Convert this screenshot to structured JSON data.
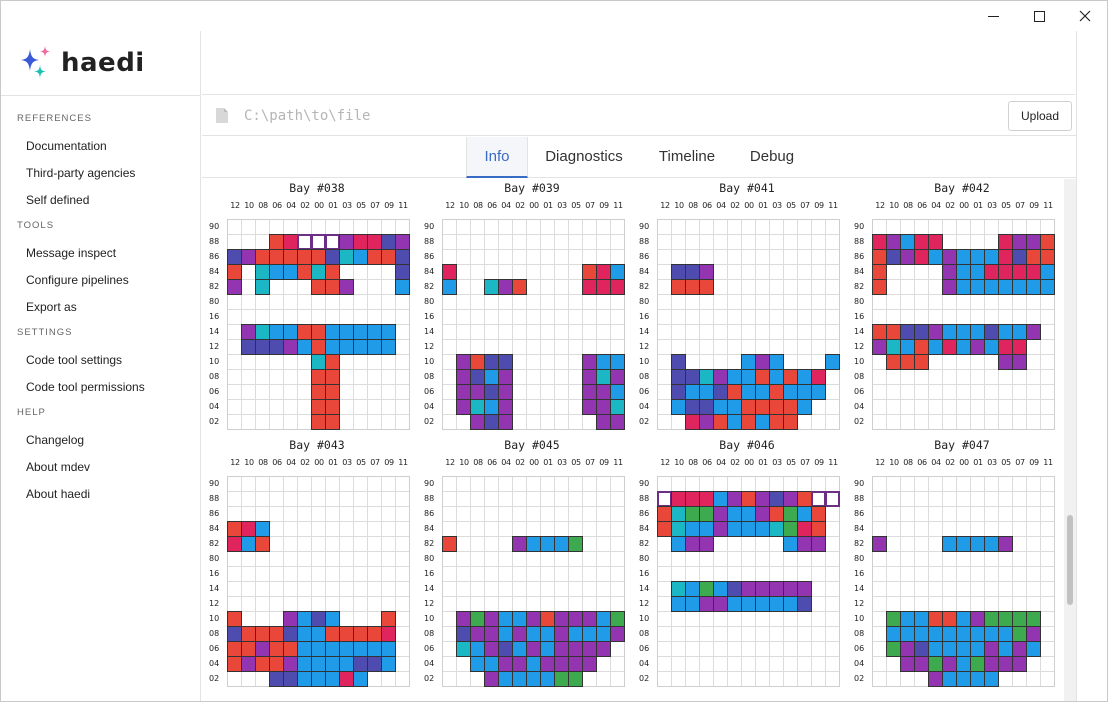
{
  "window": {
    "minimize_label": "—",
    "maximize_label": "☐",
    "close_label": "✕"
  },
  "app": {
    "name": "haedi"
  },
  "sidebar": {
    "sections": [
      {
        "title": "REFERENCES",
        "items": [
          "Documentation",
          "Third-party agencies",
          "Self defined"
        ]
      },
      {
        "title": "TOOLS",
        "items": [
          "Message inspect",
          "Configure pipelines",
          "Export as"
        ]
      },
      {
        "title": "SETTINGS",
        "items": [
          "Code tool settings",
          "Code tool permissions"
        ]
      },
      {
        "title": "HELP",
        "items": [
          "Changelog",
          "About mdev",
          "About haedi"
        ]
      }
    ]
  },
  "file": {
    "placeholder": "C:\\path\\to\\file",
    "upload_label": "Upload"
  },
  "tabs": [
    {
      "label": "Info",
      "active": true
    },
    {
      "label": "Diagnostics",
      "active": false
    },
    {
      "label": "Timeline",
      "active": false
    },
    {
      "label": "Debug",
      "active": false
    }
  ],
  "colors": {
    "accent": "#3a6bc4",
    "R": "#e8473a",
    "P": "#e0245e",
    "V": "#9334b0",
    "I": "#4f4cb0",
    "B": "#1f9be8",
    "T": "#1bb7c4",
    "G": "#3daa4f",
    "E": "#ffffff"
  },
  "bay_labels": {
    "columns": [
      "12",
      "10",
      "08",
      "06",
      "04",
      "02",
      "00",
      "01",
      "03",
      "05",
      "07",
      "09",
      "11"
    ],
    "rows": [
      "90",
      "88",
      "86",
      "84",
      "82",
      "80",
      "16",
      "14",
      "12",
      "10",
      "08",
      "06",
      "04",
      "02"
    ]
  },
  "bays": [
    {
      "title": "Bay #038",
      "rows": [
        ".............",
        "...RPEEEVPPIV",
        "IVRRRRRITBRRI",
        "R.TBBRTR....I",
        "V.T...RRV...B",
        ".............",
        ".............",
        ".VTBBRRBBBBB.",
        ".IIIVBRBBBBB.",
        "......TR.....",
        "......RR.....",
        "......RR.....",
        "......RR.....",
        "......RR....."
      ]
    },
    {
      "title": "Bay #039",
      "rows": [
        ".............",
        ".............",
        ".............",
        "P.........RPB",
        "B..TVR....PPP",
        ".............",
        ".............",
        ".............",
        ".............",
        ".VRII.....VBB",
        ".VIBV.....VTV",
        ".VVIV.....VVB",
        ".VTBV.....VVT",
        "..VIV......VV"
      ]
    },
    {
      "title": "Bay #041",
      "rows": [
        ".............",
        ".............",
        ".............",
        ".IIV.........",
        ".RRR.........",
        ".............",
        ".............",
        ".............",
        ".............",
        ".I....BVB...B",
        ".IITVBBRBRBP.",
        ".IBBIRBBRBBB.",
        ".BIIBBRRRRB..",
        "..PVRBRBRR..."
      ]
    },
    {
      "title": "Bay #042",
      "rows": [
        ".............",
        "PVBPP....PVVR",
        "RIVPBVBBBPIRR",
        "R....VBBPPPPB",
        "R....VBBBBBBB",
        ".............",
        ".............",
        "RRIIVBBBIBBV.",
        "VTBRBPBVBPP..",
        ".RRR.....VV.."
      ]
    },
    {
      "title": "Bay #043",
      "rows": [
        ".............",
        ".............",
        ".............",
        "RPB..........",
        "PBR..........",
        ".............",
        ".............",
        ".............",
        ".............",
        "R...VBIB...R.",
        "IRRRIBBRRRRP.",
        "RRVRRBBBBBBB.",
        "RVRRVBBBBIIB.",
        "...IIBBBPB..."
      ]
    },
    {
      "title": "Bay #045",
      "rows": [
        ".............",
        ".............",
        ".............",
        ".............",
        "R....VBBBG...",
        ".............",
        ".............",
        ".............",
        ".............",
        ".VGVBBVRVVVBG",
        ".IVVBVBBVBBBV",
        ".TBVIBVBVVVV.",
        "..BBVVBVVVV..",
        "...VBBBBGG..."
      ]
    },
    {
      "title": "Bay #046",
      "rows": [
        ".............",
        "EPPPBVRVIVREE",
        "RTGGVBBVRGBR.",
        "RTBBVBBBTGPR.",
        ".BVV.....BVV.",
        ".............",
        ".............",
        ".TBGBIVVVVV..",
        ".BBVVBBBBBI..",
        ".............",
        ".............",
        ".............",
        ".............",
        "............."
      ]
    },
    {
      "title": "Bay #047",
      "rows": [
        ".............",
        ".............",
        ".............",
        ".............",
        "V....BBBBV...",
        ".............",
        ".............",
        ".............",
        ".............",
        ".GBBRRBVGGGG.",
        ".BBBBBBBBBGV.",
        ".GVIBBBBVBVB.",
        "..VVGVBGVVV..",
        "....VBBBB...."
      ]
    }
  ]
}
